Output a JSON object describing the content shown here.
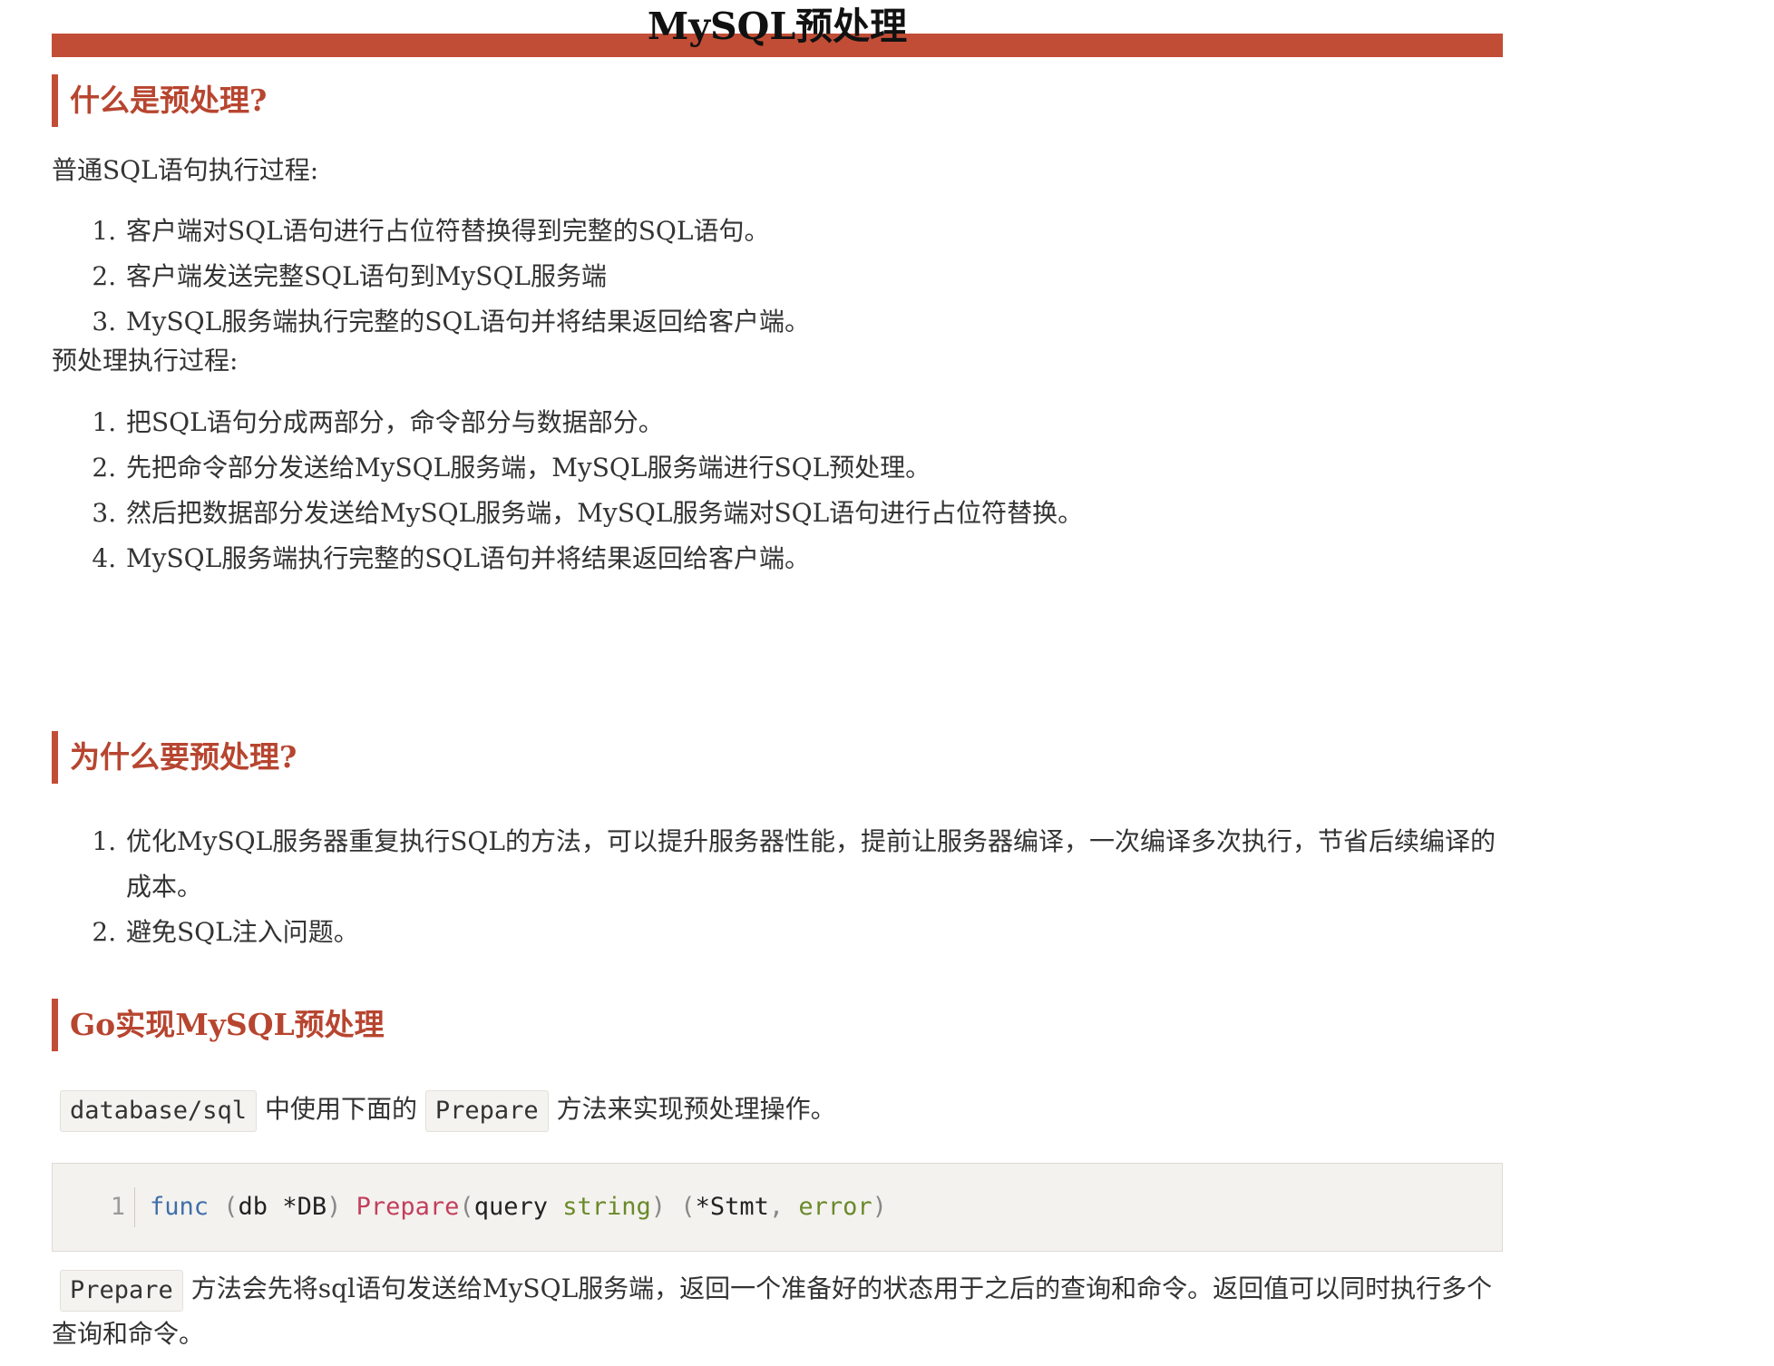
{
  "title": "MySQL预处理",
  "sections": [
    {
      "heading": "什么是预处理?",
      "normal_label": "普通SQL语句执行过程:",
      "normal_steps": [
        "客户端对SQL语句进行占位符替换得到完整的SQL语句。",
        "客户端发送完整SQL语句到MySQL服务端",
        "MySQL服务端执行完整的SQL语句并将结果返回给客户端。"
      ],
      "prep_label": "预处理执行过程:",
      "prep_steps": [
        "把SQL语句分成两部分，命令部分与数据部分。",
        "先把命令部分发送给MySQL服务端，MySQL服务端进行SQL预处理。",
        "然后把数据部分发送给MySQL服务端，MySQL服务端对SQL语句进行占位符替换。",
        "MySQL服务端执行完整的SQL语句并将结果返回给客户端。"
      ]
    },
    {
      "heading": "为什么要预处理?",
      "steps": [
        "优化MySQL服务器重复执行SQL的方法，可以提升服务器性能，提前让服务器编译，一次编译多次执行，节省后续编译的成本。",
        "避免SQL注入问题。"
      ]
    },
    {
      "heading": "Go实现MySQL预处理",
      "intro": {
        "code1": "database/sql",
        "text1": " 中使用下面的 ",
        "code2": "Prepare",
        "text2": " 方法来实现预处理操作。"
      },
      "code_block": {
        "line_number": "1",
        "tokens": {
          "kw": "func",
          "p1": " (",
          "recv": "db",
          "sp1": " ",
          "recv_type": "*DB",
          "p2": ") ",
          "fn": "Prepare",
          "p3": "(",
          "param": "query",
          "sp2": " ",
          "param_type": "string",
          "p4": ") (",
          "ret1": "*Stmt",
          "p5": ", ",
          "ret2": "error",
          "p6": ")"
        }
      },
      "outro": {
        "code": "Prepare",
        "text": " 方法会先将sql语句发送给MySQL服务端，返回一个准备好的状态用于之后的查询和命令。返回值可以同时执行多个查询和命令。"
      }
    }
  ],
  "colors": {
    "accent": "#c24d36",
    "heading": "#b7452f",
    "text": "#333333",
    "code_bg": "#f4f2ef"
  }
}
